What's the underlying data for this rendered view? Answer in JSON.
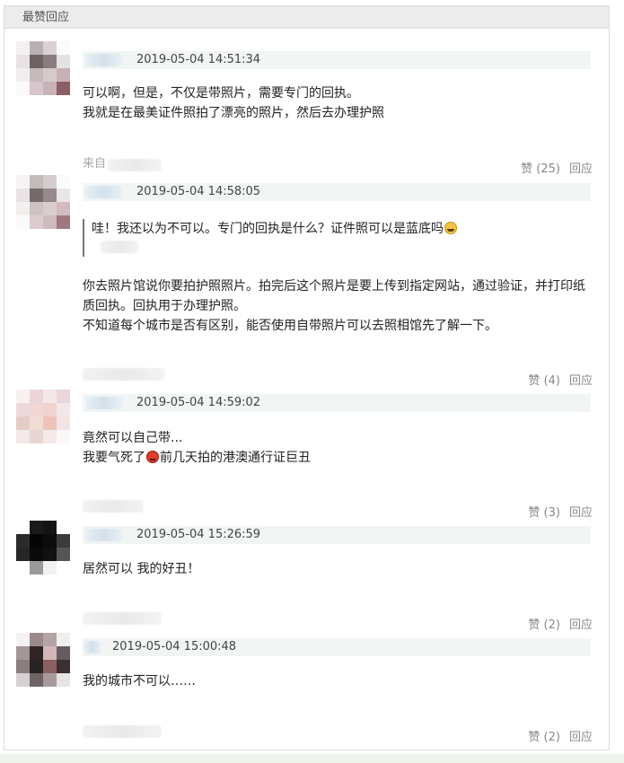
{
  "section_title": "最赞回应",
  "replies": [
    {
      "time": "2019-05-04 14:51:34",
      "lines": [
        "可以啊，但是，不仅是带照片，需要专门的回执。",
        "我就是在最美证件照拍了漂亮的照片，然后去办理护照"
      ],
      "source_prefix": "来自",
      "like_label": "赞 (25)",
      "reply_label": "回应"
    },
    {
      "time": "2019-05-04 14:58:05",
      "quote": "哇！我还以为不可以。专门的回执是什么？证件照可以是蓝底吗",
      "quote_emoji": "grinning-sweat-emoji",
      "paragraph": "你去照片馆说你要拍护照照片。拍完后这个照片是要上传到指定网站，通过验证，并打印纸质回执。回执用于办理护照。",
      "paragraph2": "不知道每个城市是否有区别，能否使用自带照片可以去照相馆先了解一下。",
      "like_label": "赞 (4)",
      "reply_label": "回应"
    },
    {
      "time": "2019-05-04 14:59:02",
      "line1": "竟然可以自己带...",
      "line2_a": "我要气死了",
      "line2_emoji": "angry-face-emoji",
      "line2_b": "前几天拍的港澳通行证巨丑",
      "like_label": "赞 (3)",
      "reply_label": "回应"
    },
    {
      "time": "2019-05-04 15:26:59",
      "text": "居然可以 我的好丑！",
      "like_label": "赞 (2)",
      "reply_label": "回应"
    },
    {
      "time": "2019-05-04 15:00:48",
      "text": "我的城市不可以……",
      "like_label": "赞 (2)",
      "reply_label": "回应"
    }
  ]
}
